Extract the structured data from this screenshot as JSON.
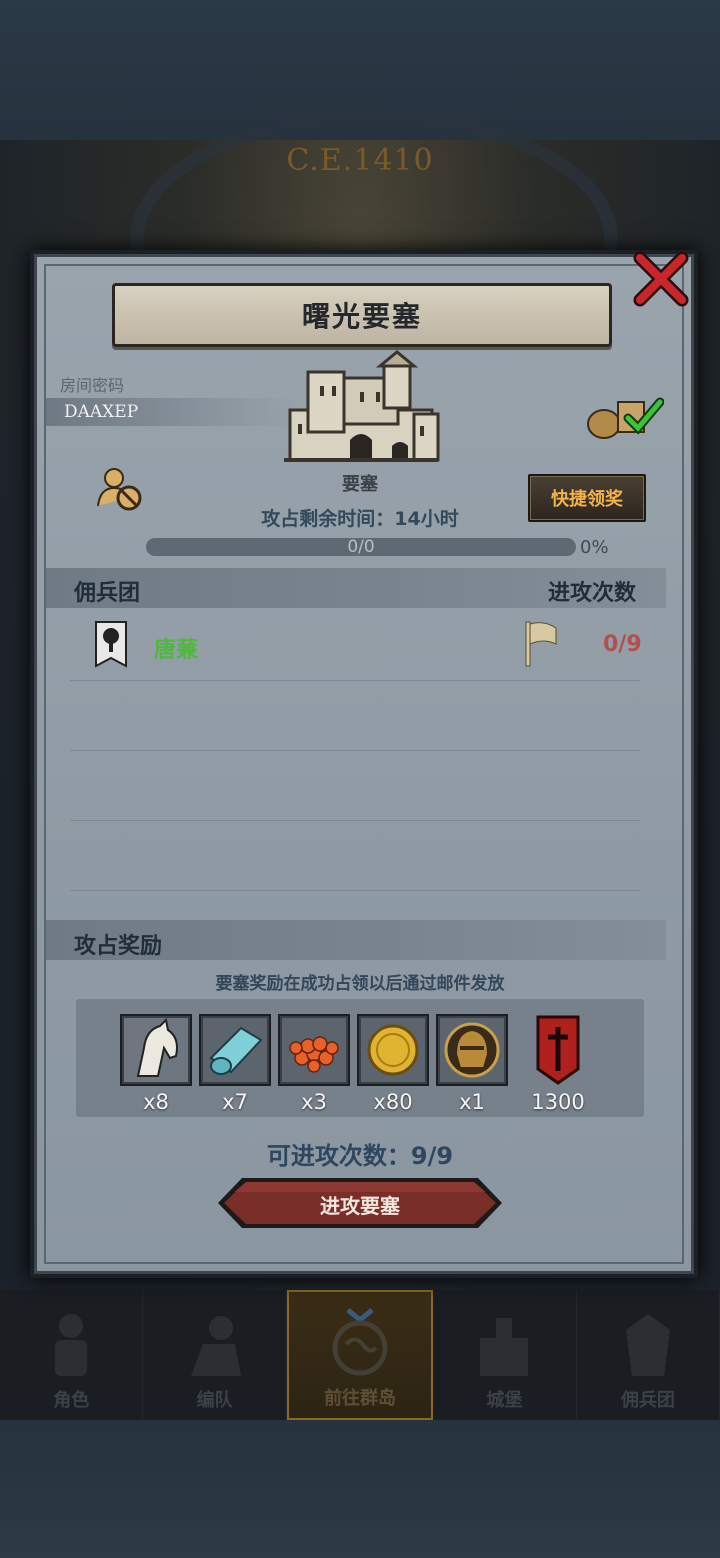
{
  "header": {
    "era": "C.E.1410"
  },
  "dialog": {
    "title": "曙光要塞",
    "room_label": "房间密码",
    "room_code": "DAAXEP",
    "fortress_label": "要塞",
    "quick_claim_label": "快捷领奖",
    "time_left": "攻占剩余时间：14小时",
    "progress": {
      "text": "0/0",
      "percent_label": "0%",
      "fraction": 0
    },
    "mercenary_header": "佣兵团",
    "attack_count_header": "进攻次数",
    "guilds": [
      {
        "name": "唐蒹",
        "count": "0/9"
      }
    ],
    "rewards_header": "攻占奖励",
    "reward_note": "要塞奖励在成功占领以后通过邮件发放",
    "rewards": [
      {
        "icon": "horse-icon",
        "qty": "x8"
      },
      {
        "icon": "cloth-icon",
        "qty": "x7"
      },
      {
        "icon": "orange-pellets-icon",
        "qty": "x3"
      },
      {
        "icon": "gold-coin-icon",
        "qty": "x80"
      },
      {
        "icon": "helmet-icon",
        "qty": "x1"
      },
      {
        "icon": "banner-icon",
        "qty": "1300"
      }
    ],
    "attacks_available": "可进攻次数：9/9",
    "attack_button_label": "进攻要塞"
  },
  "nav": [
    {
      "label": "角色",
      "icon": "knight-icon"
    },
    {
      "label": "编队",
      "icon": "squad-icon"
    },
    {
      "label": "前往群岛",
      "icon": "globe-icon",
      "active": true
    },
    {
      "label": "城堡",
      "icon": "castle-icon"
    },
    {
      "label": "佣兵团",
      "icon": "mercenary-icon"
    }
  ],
  "colors": {
    "gold": "#f2b34a",
    "green": "#4fb83d",
    "red_count": "#b05050",
    "attack_btn": "#7a2e2a"
  }
}
